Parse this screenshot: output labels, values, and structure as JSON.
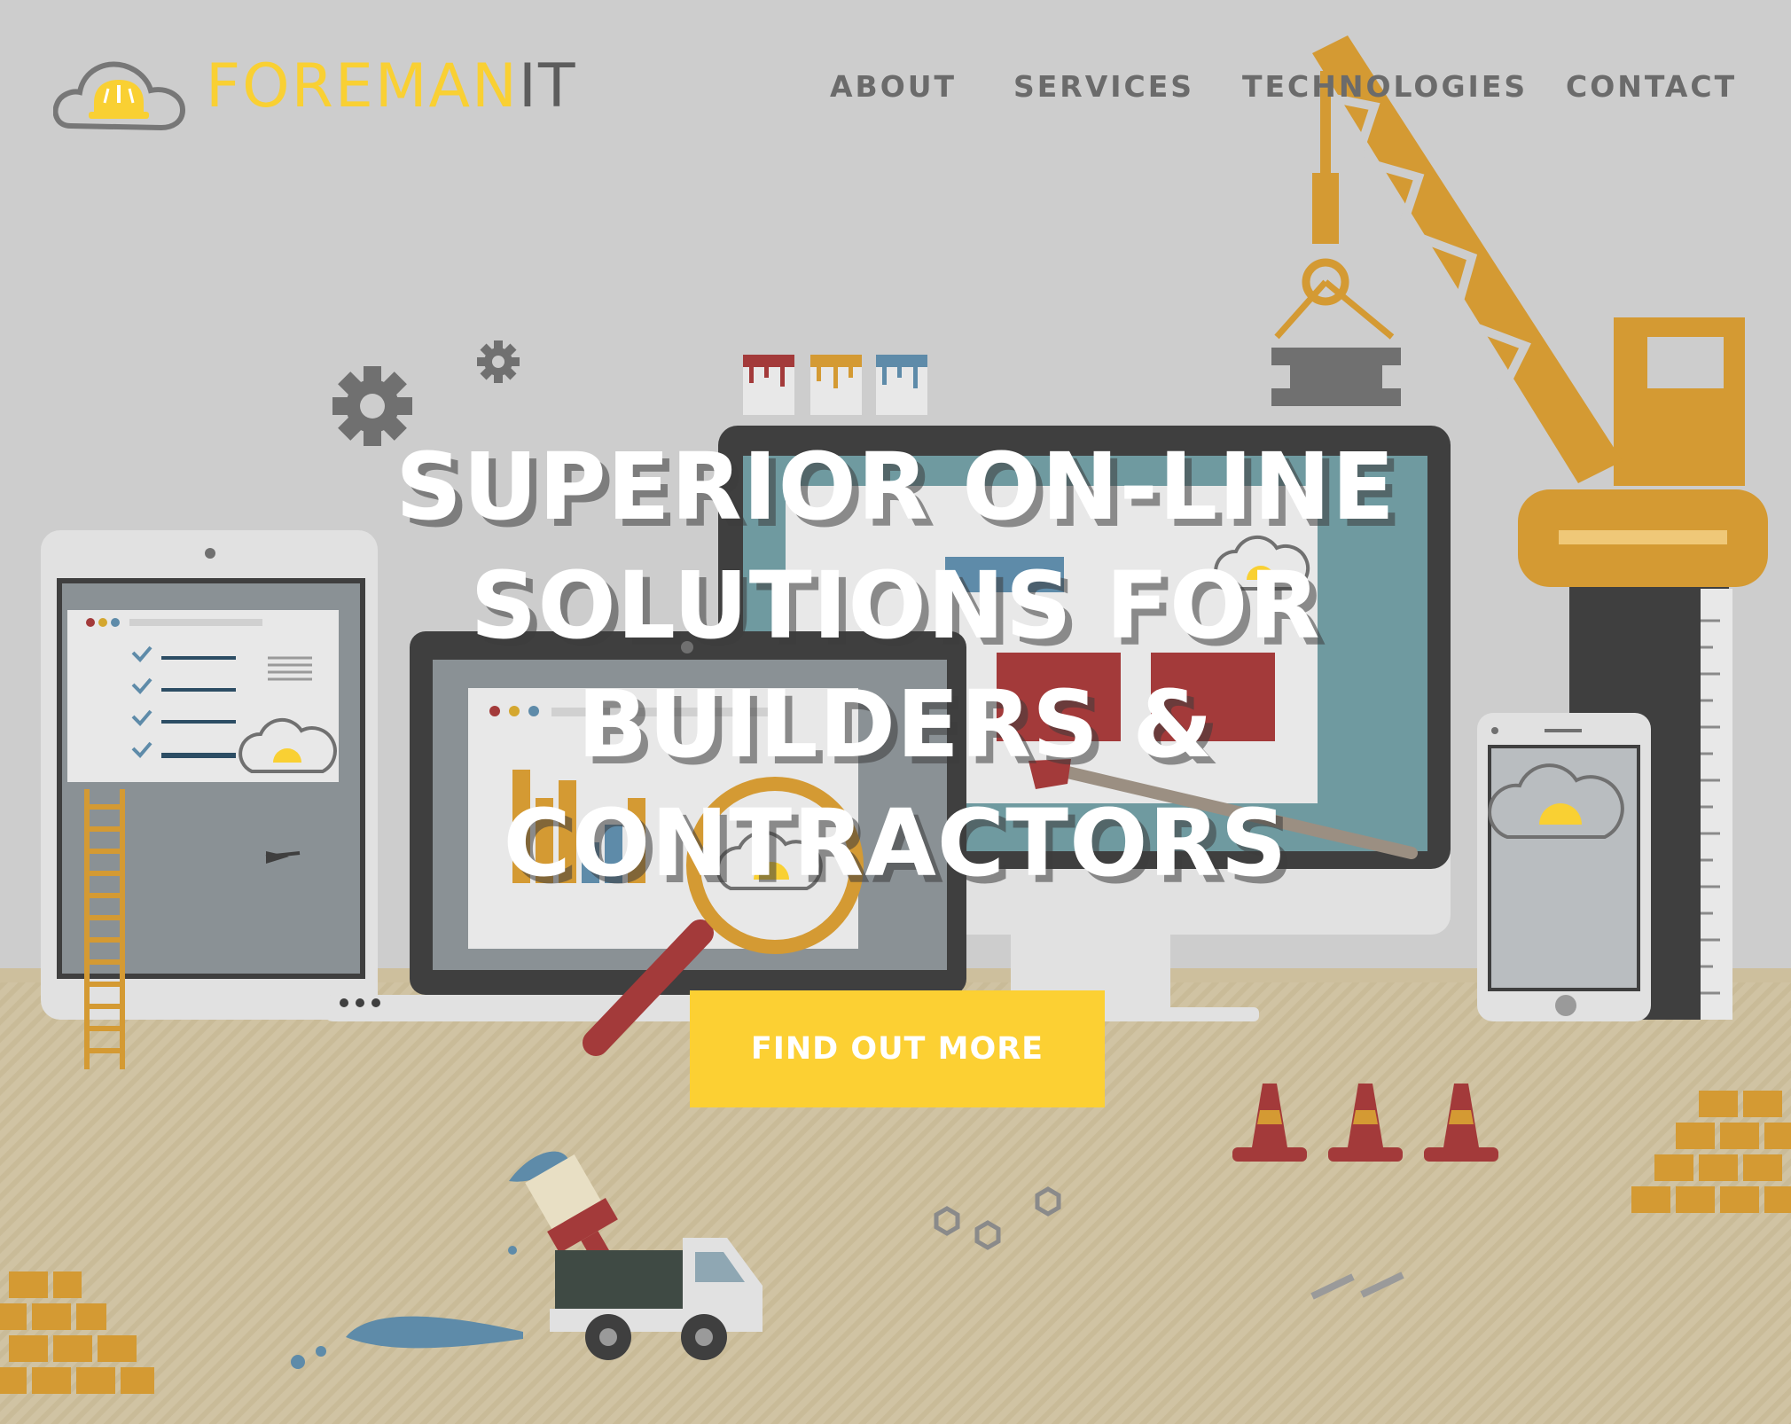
{
  "brand": {
    "name_part1": "FOREMAN",
    "name_part2": "IT",
    "logo_icon": "cloud-hard-hat-icon",
    "accent_color": "#f9d033",
    "secondary_color": "#5d5d5d"
  },
  "nav": {
    "items": [
      {
        "label": "ABOUT"
      },
      {
        "label": "SERVICES"
      },
      {
        "label": "TECHNOLOGIES"
      },
      {
        "label": "CONTACT"
      }
    ]
  },
  "hero": {
    "title_lines": [
      "SUPERIOR ON-LINE",
      "SOLUTIONS FOR",
      "BUILDERS &",
      "CONTRACTORS"
    ],
    "cta_label": "FIND OUT MORE",
    "cta_color": "#fcd033"
  },
  "illustration": {
    "icons": [
      "crane-icon",
      "gear-icon",
      "tablet-icon",
      "laptop-icon",
      "desktop-monitor-icon",
      "smartphone-icon",
      "magnifying-glass-icon",
      "paint-brush-icon",
      "ladder-icon",
      "traffic-cone-icon",
      "brick-stack-icon",
      "dump-truck-icon",
      "paint-bucket-icon",
      "nut-icon",
      "screw-icon",
      "ruler-icon",
      "checklist-icon",
      "bar-chart-icon",
      "arrow-cursor-icon"
    ]
  }
}
